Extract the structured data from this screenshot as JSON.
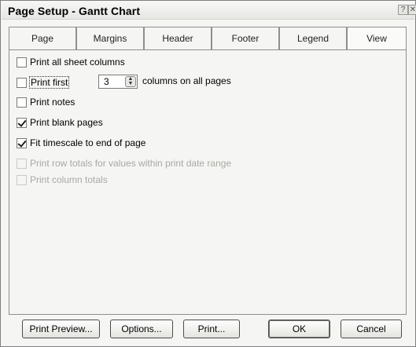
{
  "window": {
    "title": "Page Setup - Gantt Chart",
    "help_glyph": "?",
    "close_glyph": "✕"
  },
  "tabs": [
    {
      "label": "Page"
    },
    {
      "label": "Margins"
    },
    {
      "label": "Header"
    },
    {
      "label": "Footer"
    },
    {
      "label": "Legend"
    },
    {
      "label": "View",
      "active": true
    }
  ],
  "options": {
    "print_all_sheet_columns": {
      "label": "Print all sheet columns",
      "checked": false,
      "enabled": true
    },
    "print_first": {
      "label": "Print first",
      "checked": false,
      "enabled": true,
      "value": "3",
      "suffix": "columns on all pages"
    },
    "print_notes": {
      "label": "Print notes",
      "checked": false,
      "enabled": true
    },
    "print_blank_pages": {
      "label": "Print blank pages",
      "checked": true,
      "enabled": true
    },
    "fit_timescale": {
      "label": "Fit timescale to end of page",
      "checked": true,
      "enabled": true
    },
    "print_row_totals": {
      "label": "Print row totals for values within print date range",
      "checked": false,
      "enabled": false
    },
    "print_column_totals": {
      "label": "Print column totals",
      "checked": false,
      "enabled": false
    }
  },
  "buttons": {
    "print_preview": "Print Preview...",
    "options": "Options...",
    "print": "Print...",
    "ok": "OK",
    "cancel": "Cancel"
  }
}
